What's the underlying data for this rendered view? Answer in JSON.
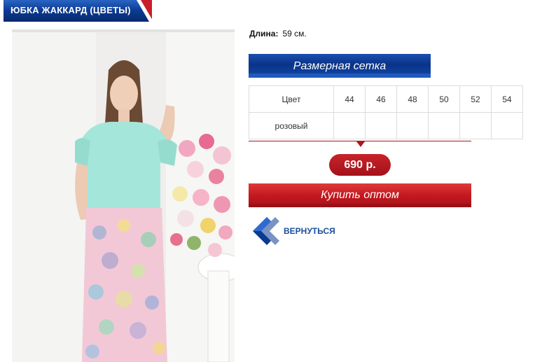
{
  "product": {
    "title": "ЮБКА ЖАККАРД (ЦВЕТЫ)",
    "length_label": "Длина:",
    "length_value": "59 см.",
    "size_chart_label": "Размерная сетка",
    "price": "690 р.",
    "buy_label": "Купить оптом",
    "back_label": "ВЕРНУТЬСЯ"
  },
  "size_table": {
    "header": [
      "Цвет",
      "44",
      "46",
      "48",
      "50",
      "52",
      "54"
    ],
    "rows": [
      [
        "розовый",
        "",
        "",
        "",
        "",
        "",
        ""
      ]
    ]
  },
  "colors": {
    "brand_blue": "#0b3a91",
    "brand_red": "#c8202a",
    "link_blue": "#1a4f9c"
  }
}
